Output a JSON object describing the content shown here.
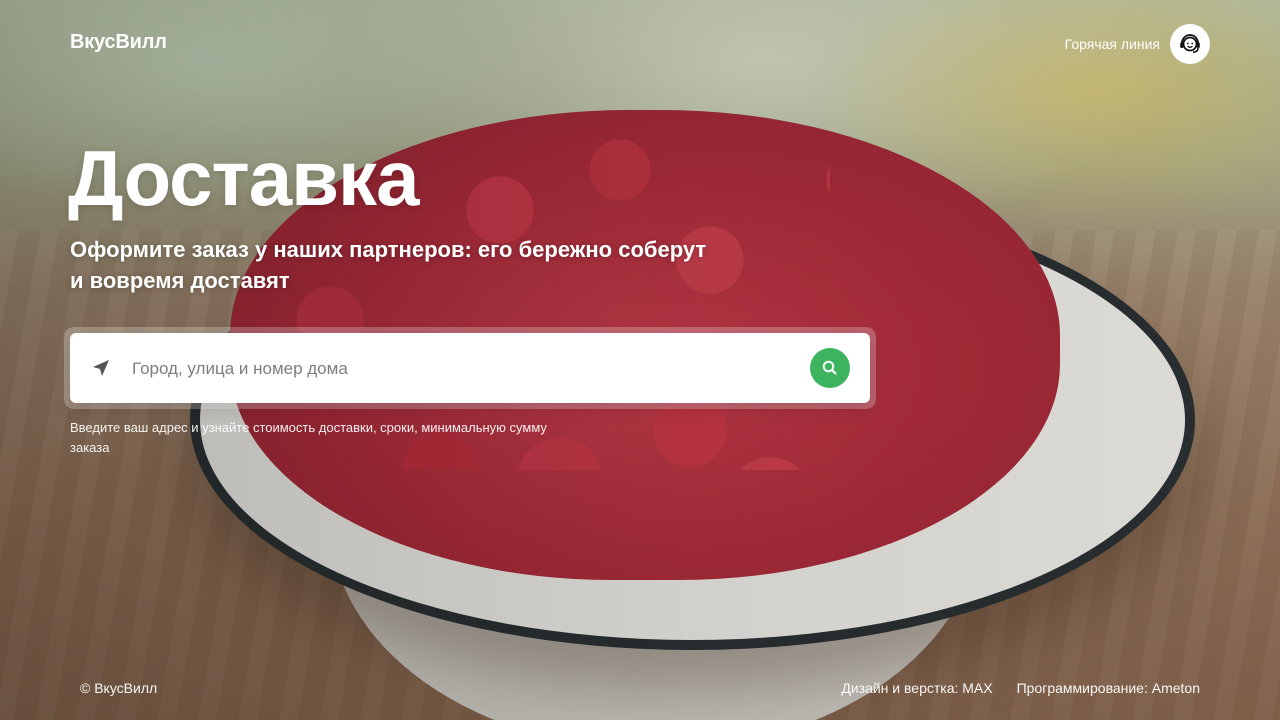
{
  "header": {
    "logo": "ВкусВилл",
    "hotline_label": "Горячая линия",
    "hotline_icon": "support-agent-icon"
  },
  "hero": {
    "title": "Доставка",
    "subtitle": "Оформите заказ у наших партнеров: его бережно соберут и вовремя доставят"
  },
  "search": {
    "placeholder": "Город, улица и номер дома",
    "location_icon": "location-arrow-icon",
    "button_icon": "search-icon",
    "hint": "Введите ваш адрес и узнайте стоимость доставки, сроки, минимальную сумму заказа"
  },
  "footer": {
    "copyright": "© ВкусВилл",
    "design_credit": "Дизайн и верстка: MAX",
    "dev_credit": "Программирование: Ameton"
  },
  "colors": {
    "accent": "#3cb35e",
    "text_on_photo": "#ffffff"
  }
}
